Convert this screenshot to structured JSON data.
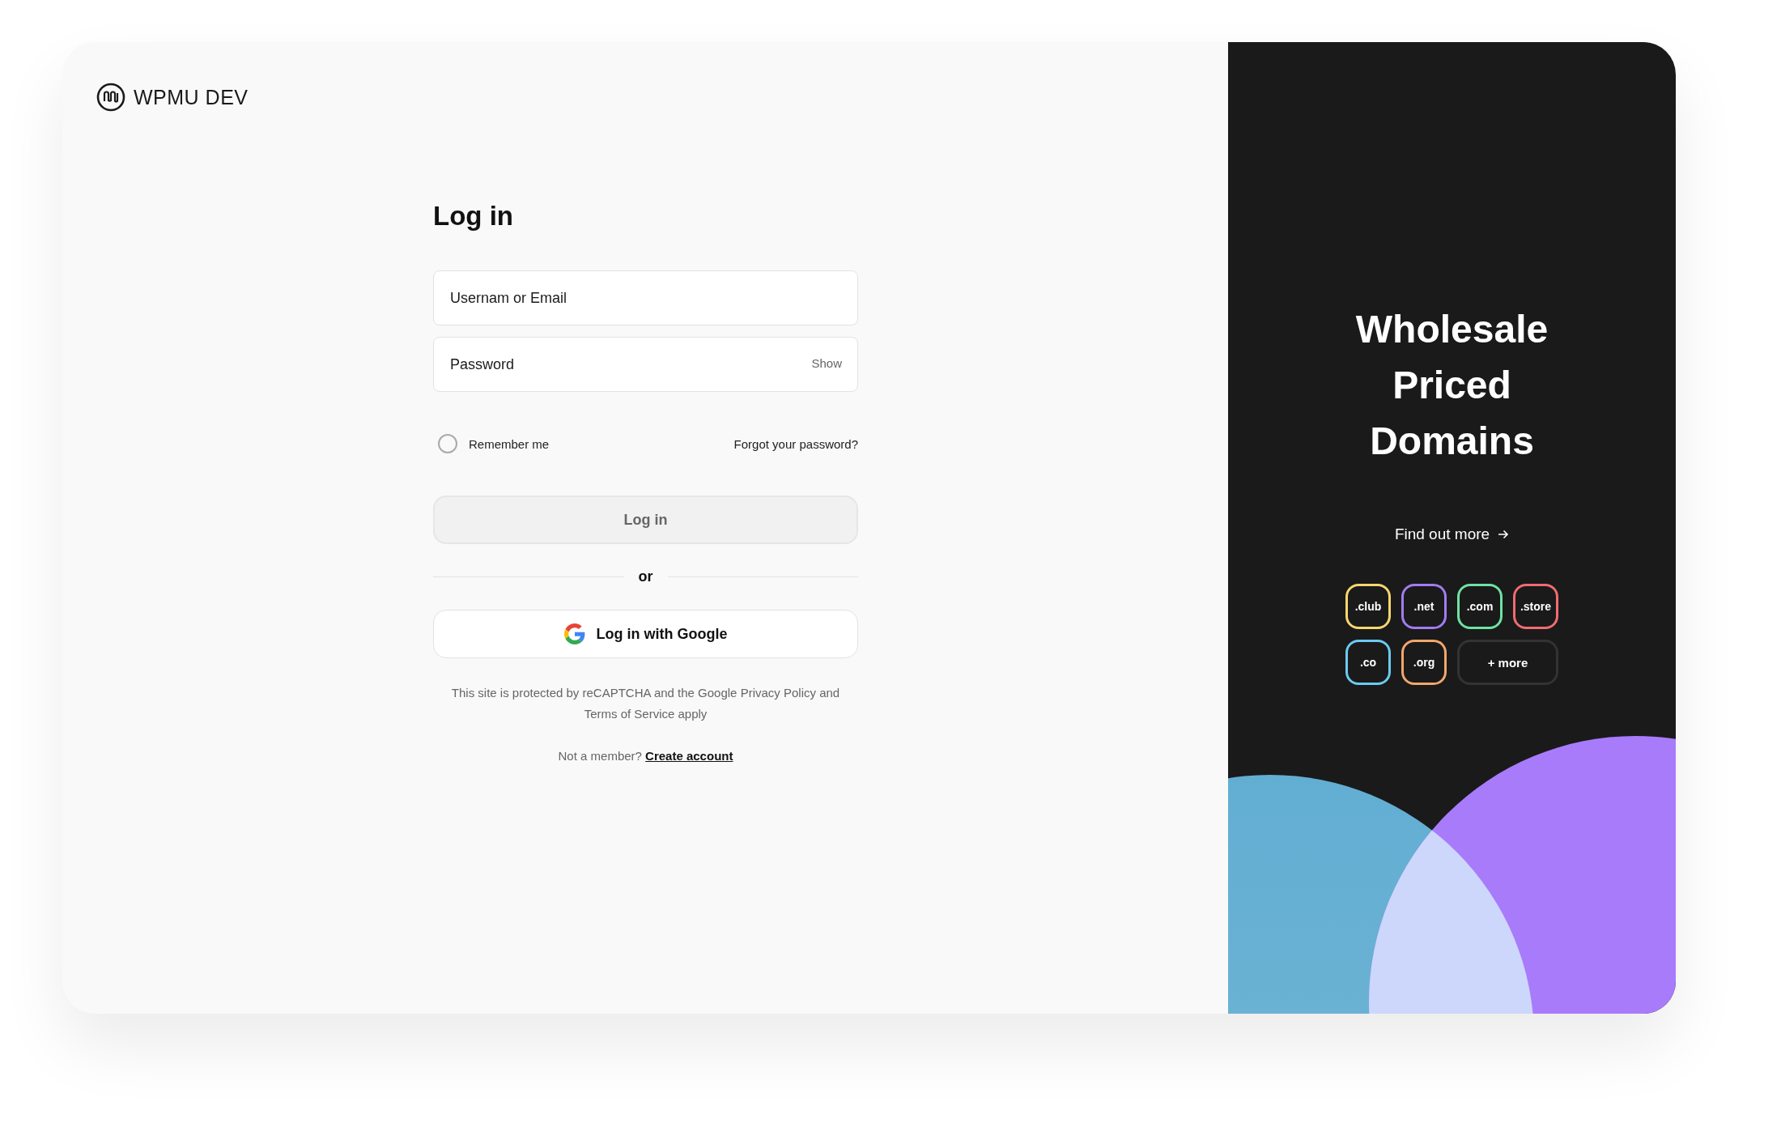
{
  "brand": {
    "name": "WPMU DEV"
  },
  "form": {
    "title": "Log in",
    "username": {
      "placeholder": "Usernam or Email"
    },
    "password": {
      "placeholder": "Password",
      "toggle": "Show"
    },
    "remember_me": {
      "label": "Remember me",
      "checked": false
    },
    "forgot_link": "Forgot your password?",
    "login_button": {
      "label": "Log in",
      "disabled": true
    },
    "divider": "or",
    "google_button": "Log in with Google",
    "notice": "This site is protected by reCAPTCHA and the Google Privacy Policy and Terms of Service apply",
    "signup_prompt": "Not a member?",
    "signup_link": "Create account"
  },
  "promo": {
    "headline": "Wholesale Priced Domains",
    "link": "Find out more",
    "domains": [
      {
        "label": ".club",
        "kind": "tld",
        "color": "#f7d66e"
      },
      {
        "label": ".net",
        "kind": "tld",
        "color": "#a27cf2"
      },
      {
        "label": ".com",
        "kind": "tld",
        "color": "#6ee2a3"
      },
      {
        "label": ".store",
        "kind": "tld",
        "color": "#f26b73"
      },
      {
        "label": ".co",
        "kind": "tld",
        "color": "#6ccaf2"
      },
      {
        "label": ".org",
        "kind": "tld",
        "color": "#f5a66b"
      },
      {
        "label": "+ more",
        "kind": "more"
      }
    ]
  }
}
